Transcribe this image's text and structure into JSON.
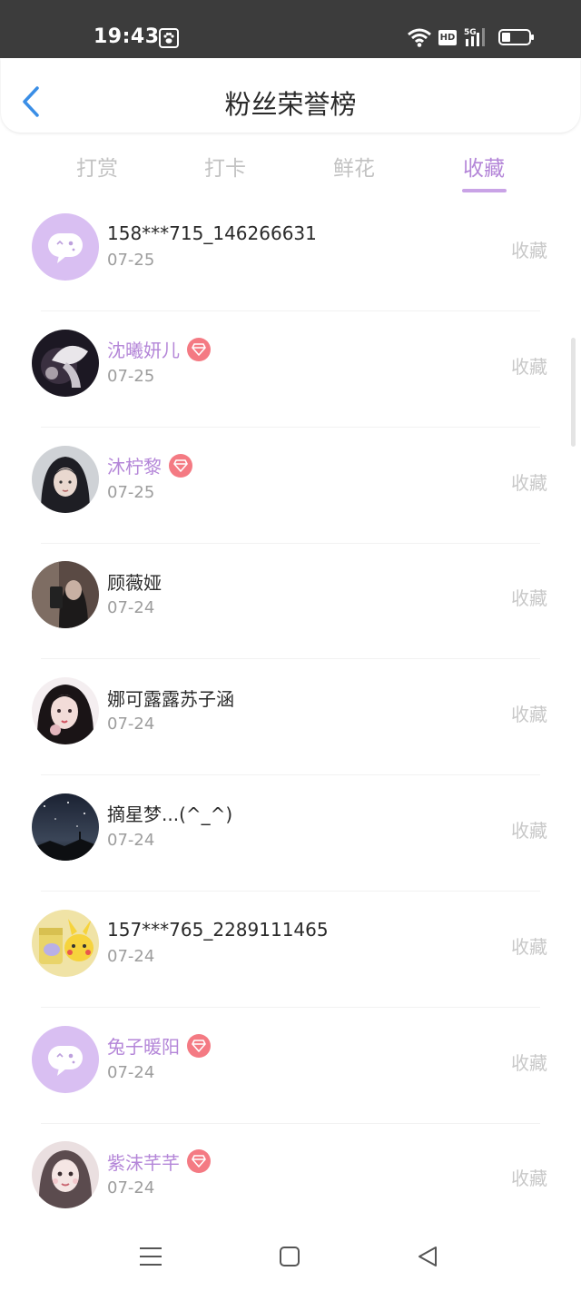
{
  "status_bar": {
    "time": "19:43",
    "hd_label": "HD",
    "network_label": "5G",
    "icons": [
      "paw-app-icon",
      "wifi-icon",
      "hd-icon",
      "signal-5g-icon",
      "battery-icon"
    ]
  },
  "header": {
    "title": "粉丝荣誉榜",
    "back_icon": "chevron-left-icon"
  },
  "tabs": [
    {
      "label": "打赏",
      "active": false
    },
    {
      "label": "打卡",
      "active": false
    },
    {
      "label": "鲜花",
      "active": false
    },
    {
      "label": "收藏",
      "active": true
    }
  ],
  "fans": [
    {
      "name": "158***715_146266631",
      "date": "07-25",
      "action": "收藏",
      "vip": false,
      "avatar": "default-chat-bubble"
    },
    {
      "name": "沈曦妍儿",
      "date": "07-25",
      "action": "收藏",
      "vip": true,
      "avatar": "photo-white-flower"
    },
    {
      "name": "沐柠黎",
      "date": "07-25",
      "action": "收藏",
      "vip": true,
      "avatar": "photo-dark-hair-girl"
    },
    {
      "name": "顾薇娅",
      "date": "07-24",
      "action": "收藏",
      "vip": false,
      "avatar": "photo-mirror-selfie"
    },
    {
      "name": "娜可露露苏子涵",
      "date": "07-24",
      "action": "收藏",
      "vip": false,
      "avatar": "photo-portrait-girl"
    },
    {
      "name": "摘星梦...(^_^)",
      "date": "07-24",
      "action": "收藏",
      "vip": false,
      "avatar": "photo-night-sky"
    },
    {
      "name": "157***765_2289111465",
      "date": "07-24",
      "action": "收藏",
      "vip": false,
      "avatar": "photo-pikachu"
    },
    {
      "name": "兔子暖阳",
      "date": "07-24",
      "action": "收藏",
      "vip": true,
      "avatar": "default-chat-bubble"
    },
    {
      "name": "紫沫芊芊",
      "date": "07-24",
      "action": "收藏",
      "vip": true,
      "avatar": "photo-blurry-selfie"
    }
  ],
  "colors": {
    "accent": "#b486d8",
    "tab_underline": "#c9a3e6",
    "vip_badge": "#f47a83",
    "default_avatar_bg": "#d9bff2",
    "status_bar_bg": "#3c3c3c",
    "inactive_text": "#c2c2c2",
    "back_arrow": "#3a8ee6"
  },
  "nav_bar": {
    "icons": [
      "menu-icon",
      "home-square-icon",
      "back-triangle-icon"
    ]
  }
}
